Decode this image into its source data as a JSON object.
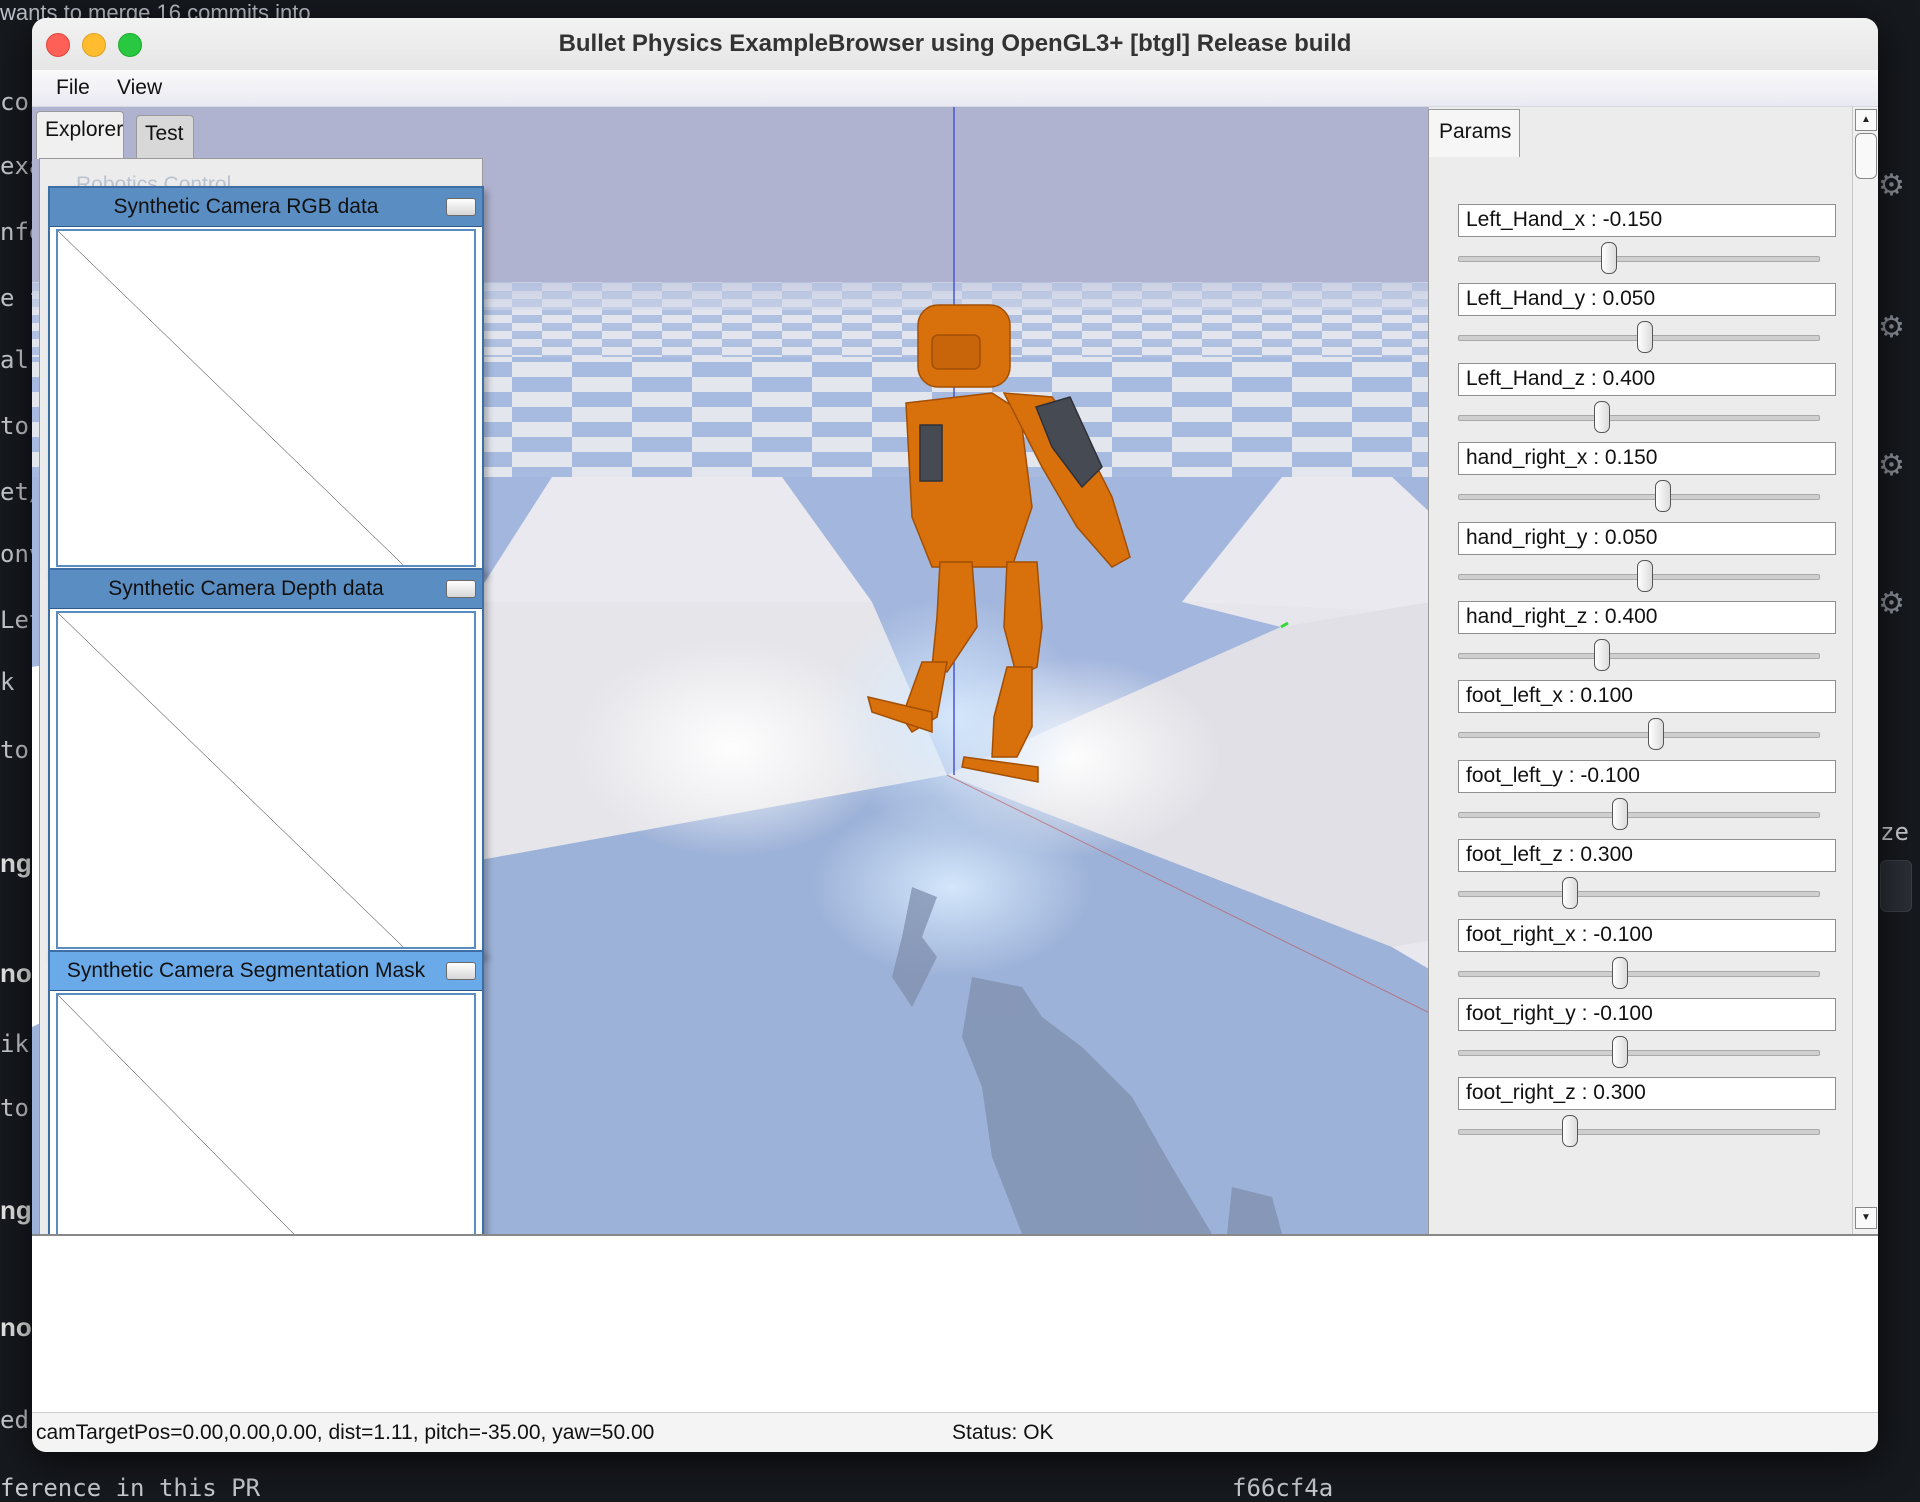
{
  "window": {
    "title": "Bullet Physics ExampleBrowser using OpenGL3+ [btgl] Release build"
  },
  "menu": {
    "items": [
      "File",
      "View"
    ]
  },
  "explorer": {
    "tabs": [
      {
        "label": "Explorer",
        "active": true
      },
      {
        "label": "Test",
        "active": false
      }
    ],
    "hidden_item": "Robotics Control"
  },
  "camera_windows": [
    {
      "title": "Synthetic Camera RGB data",
      "active": false
    },
    {
      "title": "Synthetic Camera Depth data",
      "active": false
    },
    {
      "title": "Synthetic Camera Segmentation Mask",
      "active": true
    }
  ],
  "params": {
    "tab_label": "Params",
    "sliders": [
      {
        "label": "Left_Hand_x : -0.150",
        "level": 0.42
      },
      {
        "label": "Left_Hand_y : 0.050",
        "level": 0.52
      },
      {
        "label": "Left_Hand_z : 0.400",
        "level": 0.4
      },
      {
        "label": "hand_right_x : 0.150",
        "level": 0.57
      },
      {
        "label": "hand_right_y : 0.050",
        "level": 0.52
      },
      {
        "label": "hand_right_z : 0.400",
        "level": 0.4
      },
      {
        "label": "foot_left_x : 0.100",
        "level": 0.55
      },
      {
        "label": "foot_left_y : -0.100",
        "level": 0.45
      },
      {
        "label": "foot_left_z : 0.300",
        "level": 0.31
      },
      {
        "label": "foot_right_x : -0.100",
        "level": 0.45
      },
      {
        "label": "foot_right_y : -0.100",
        "level": 0.45
      },
      {
        "label": "foot_right_z : 0.300",
        "level": 0.31
      }
    ]
  },
  "status": {
    "camera": "camTargetPos=0.00,0.00,0.00, dist=1.11, pitch=-35.00, yaw=50.00",
    "state": "Status: OK"
  },
  "background": {
    "top_text": "wants to merge 16 commits into",
    "bottom_left": "ference in this PR",
    "bottom_right": "f66cf4a",
    "side_right": "ze",
    "left_snippets": [
      "co",
      "exa",
      "nfe",
      "e f",
      "al",
      "tor",
      "et/",
      "onv",
      "Let",
      "k",
      "tor",
      "ng",
      "no",
      "ik",
      "tor",
      "ng",
      "no",
      "ed"
    ]
  },
  "colors": {
    "sky": "#b0b3d0",
    "floor_blue": "#9db2d8",
    "floor_white": "#e6e6ec",
    "robot": "#d8700c",
    "robot_dark": "#464a52",
    "cam_header": "#5a8dc2",
    "cam_header_active": "#6aaae8"
  }
}
